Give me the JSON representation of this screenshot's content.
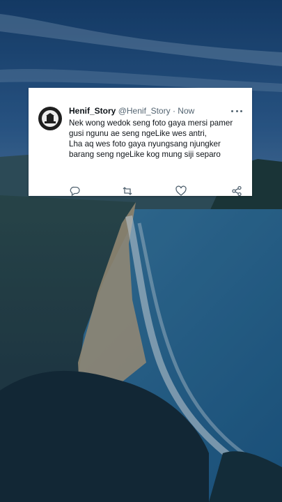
{
  "tweet": {
    "display_name": "Henif_Story",
    "handle": "@Henif_Story",
    "separator": "·",
    "time": "Now",
    "text_line_1": "Nek wong wedok seng foto gaya mersi pamer gusi ngunu ae seng ngeLike wes antri,",
    "text_line_2": "Lha aq wes foto gaya nyungsang njungker barang seng ngeLike kog mung siji separo"
  },
  "icons": {
    "more": "more-horizontal-icon",
    "reply": "reply-icon",
    "retweet": "retweet-icon",
    "like": "heart-icon",
    "share": "share-icon"
  },
  "colors": {
    "text_primary": "#0f1419",
    "text_secondary": "#536471",
    "card_bg": "#ffffff"
  }
}
